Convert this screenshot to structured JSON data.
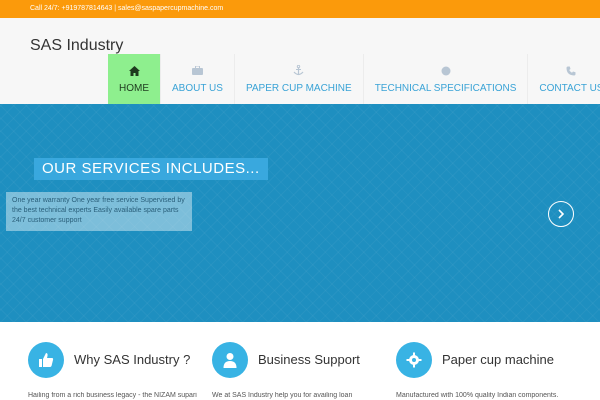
{
  "topbar": {
    "contact": "Call 24/7: +919787814643 | sales@saspapercupmachine.com"
  },
  "brand": "SAS Industry",
  "nav": {
    "items": [
      {
        "label": "HOME",
        "icon": "home-icon"
      },
      {
        "label": "ABOUT US",
        "icon": "briefcase-icon"
      },
      {
        "label": "PAPER CUP MACHINE",
        "icon": "anchor-icon"
      },
      {
        "label": "TECHNICAL SPECIFICATIONS",
        "icon": "circle-icon"
      },
      {
        "label": "CONTACT US",
        "icon": "phone-icon"
      }
    ],
    "active": "HOME"
  },
  "hero": {
    "title": "OUR SERVICES INCLUDES...",
    "caption": "One year warranty One year free service Supervised by the best technical experts Easily available spare parts 24/7 customer support"
  },
  "features": [
    {
      "title": "Why SAS Industry ?",
      "text": "Hailing from a rich business legacy - the NIZAM supari",
      "icon": "thumbs-up-icon"
    },
    {
      "title": "Business Support",
      "text": "We at SAS Industry help you for availing loan",
      "icon": "user-icon"
    },
    {
      "title": "Paper cup machine",
      "text": "Manufactured with 100% quality Indian components.",
      "icon": "gear-icon"
    }
  ],
  "colors": {
    "topbar": "#fb9a0b",
    "hero": "#1e8fc0",
    "nav_active": "#8eef8e",
    "nav_link": "#3aa3d6",
    "feature_icon": "#38b3e4"
  }
}
